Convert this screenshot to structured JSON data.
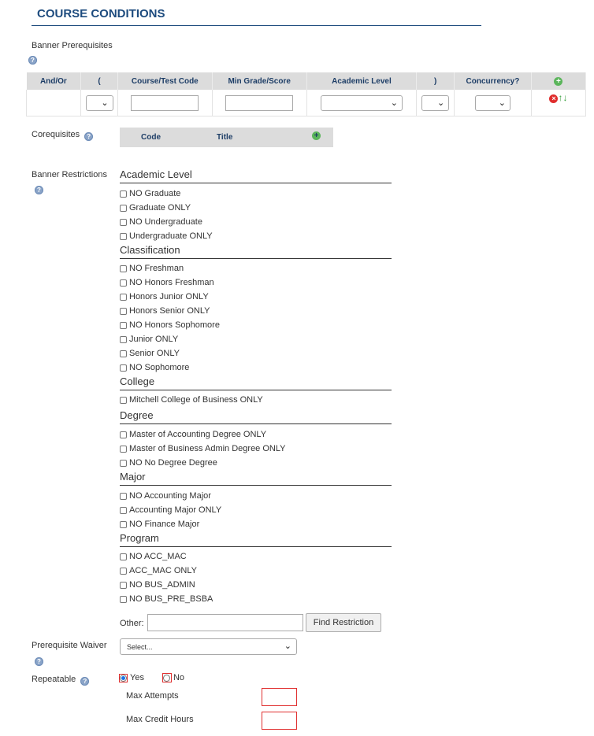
{
  "section_title": "COURSE CONDITIONS",
  "prereq": {
    "label": "Banner Prerequisites",
    "columns": [
      "And/Or",
      "(",
      "Course/Test Code",
      "Min Grade/Score",
      "Academic Level",
      ")",
      "Concurrency?"
    ]
  },
  "coreq": {
    "label": "Corequisites",
    "columns": [
      "Code",
      "Title"
    ]
  },
  "restrictions": {
    "label": "Banner Restrictions",
    "groups": [
      {
        "title": "Academic Level",
        "items": [
          "NO Graduate",
          "Graduate ONLY",
          "NO Undergraduate",
          "Undergraduate ONLY"
        ]
      },
      {
        "title": "Classification",
        "items": [
          "NO Freshman",
          "NO Honors Freshman",
          "Honors Junior ONLY",
          "Honors Senior ONLY",
          "NO Honors Sophomore",
          "Junior ONLY",
          "Senior ONLY",
          "NO Sophomore"
        ]
      },
      {
        "title": "College",
        "items": [
          "Mitchell College of Business ONLY"
        ]
      },
      {
        "title": "Degree",
        "items": [
          "Master of Accounting Degree ONLY",
          "Master of Business Admin Degree ONLY",
          "NO No Degree Degree"
        ]
      },
      {
        "title": "Major",
        "items": [
          "NO Accounting Major",
          "Accounting Major ONLY",
          "NO Finance Major"
        ]
      },
      {
        "title": "Program",
        "items": [
          "NO ACC_MAC",
          "ACC_MAC ONLY",
          "NO BUS_ADMIN",
          "NO BUS_PRE_BSBA"
        ]
      }
    ],
    "other_label": "Other:",
    "find_button": "Find Restriction"
  },
  "waiver": {
    "label": "Prerequisite Waiver",
    "selected": "Select..."
  },
  "repeatable": {
    "label": "Repeatable",
    "yes_label": "Yes",
    "no_label": "No",
    "selected": "Yes",
    "max_attempts_label": "Max Attempts",
    "max_credit_label": "Max Credit Hours"
  },
  "colors": {
    "accent": "#1d4b7e",
    "header_bg": "#dcdcdc",
    "error": "#e03030",
    "add": "#5bb55b"
  }
}
